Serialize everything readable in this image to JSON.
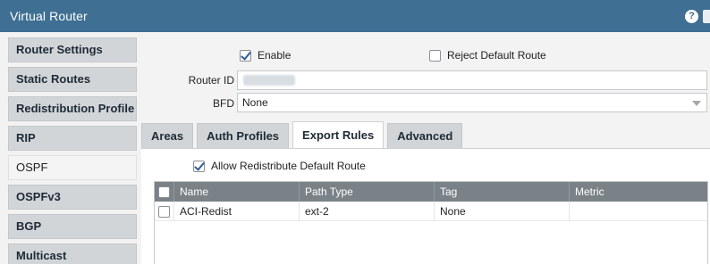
{
  "window": {
    "title": "Virtual Router"
  },
  "sidebar": {
    "items": [
      {
        "label": "Router Settings"
      },
      {
        "label": "Static Routes"
      },
      {
        "label": "Redistribution Profile"
      },
      {
        "label": "RIP"
      },
      {
        "label": "OSPF"
      },
      {
        "label": "OSPFv3"
      },
      {
        "label": "BGP"
      },
      {
        "label": "Multicast"
      }
    ],
    "active": "OSPF"
  },
  "settings": {
    "enable_label": "Enable",
    "enable_checked": true,
    "reject_default_label": "Reject Default Route",
    "reject_default_checked": false,
    "router_id_label": "Router ID",
    "bfd_label": "BFD",
    "bfd_value": "None"
  },
  "tabs": [
    {
      "label": "Areas"
    },
    {
      "label": "Auth Profiles"
    },
    {
      "label": "Export Rules"
    },
    {
      "label": "Advanced"
    }
  ],
  "active_tab": "Export Rules",
  "export_rules": {
    "allow_redistribute_label": "Allow Redistribute Default Route",
    "allow_redistribute_checked": true,
    "columns": [
      "Name",
      "Path Type",
      "Tag",
      "Metric"
    ],
    "rows": [
      {
        "name": "ACI-Redist",
        "path_type": "ext-2",
        "tag": "None",
        "metric": ""
      }
    ]
  },
  "colors": {
    "titlebar": "#3f6f93",
    "nav_item": "#d2d5d8",
    "grid_header": "#7a8288",
    "check_accent": "#2d5f95"
  }
}
